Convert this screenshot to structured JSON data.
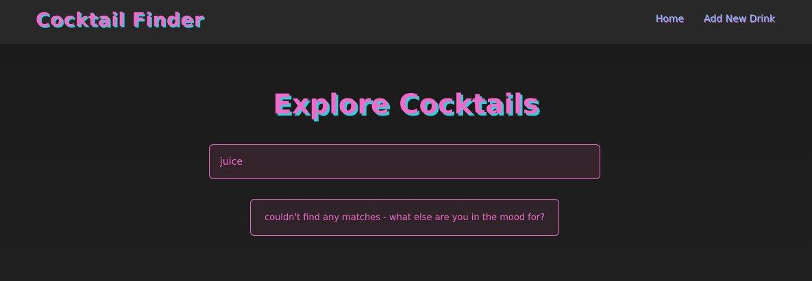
{
  "header": {
    "brand": "Cocktail Finder",
    "nav": [
      {
        "label": "Home"
      },
      {
        "label": "Add New Drink"
      }
    ]
  },
  "main": {
    "title": "Explore Cocktails",
    "search": {
      "value": "juice"
    },
    "message": "couldn't find any matches - what else are you in the mood for?"
  },
  "colors": {
    "accent_pink": "#f06bc9",
    "accent_cyan": "#2bd2d9",
    "link_blue": "#7ec3ff",
    "background": "#1c1c1c",
    "navbar": "#282828"
  }
}
